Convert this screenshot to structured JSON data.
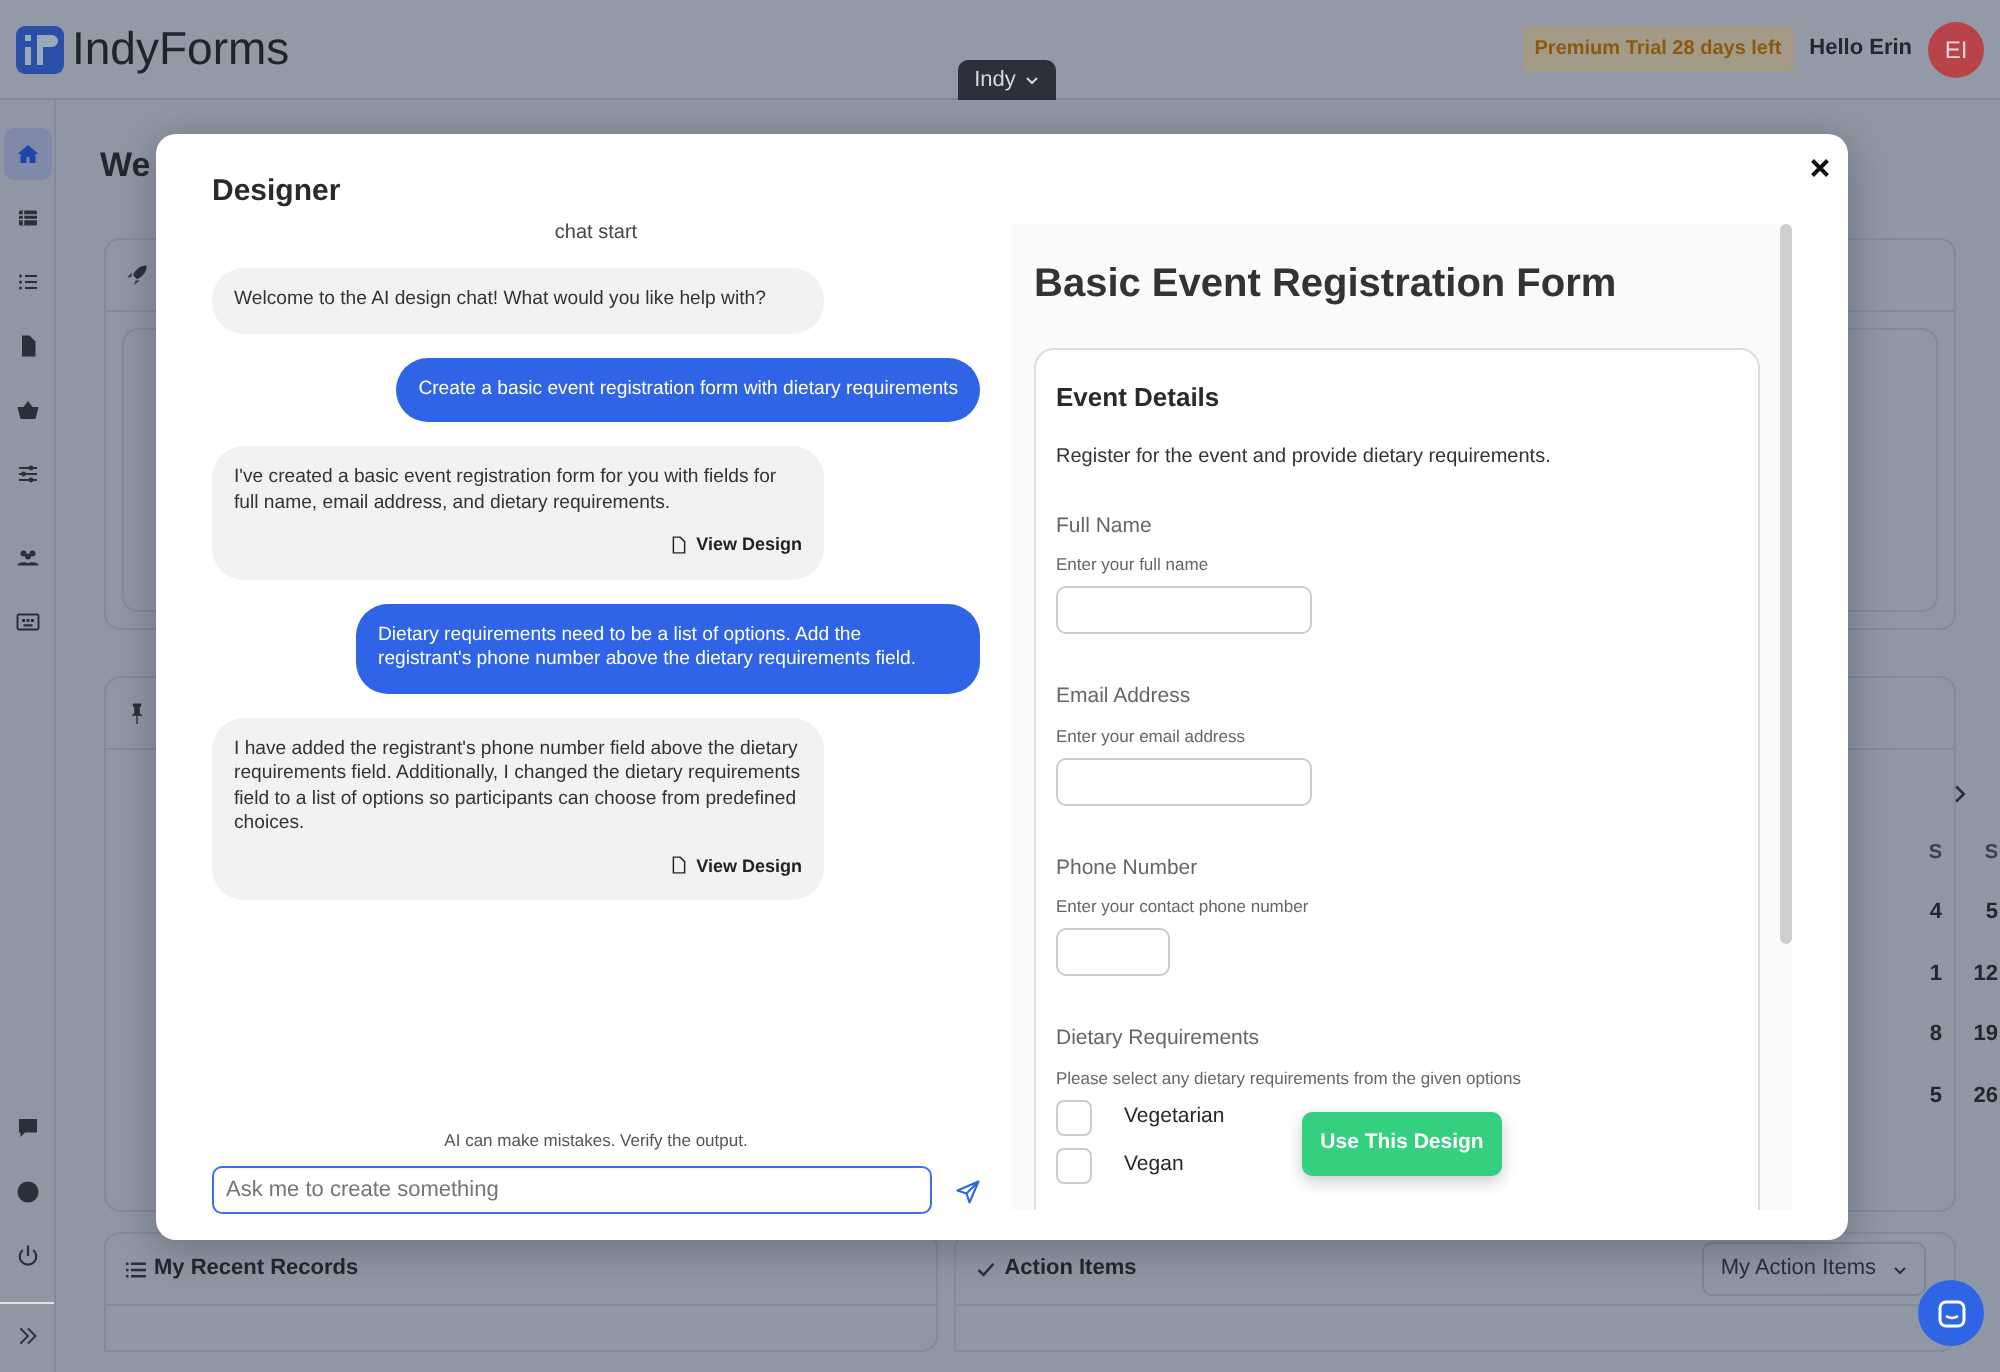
{
  "app": {
    "logo": "IndyForms",
    "workspace_tab": "Indy",
    "trial_badge": "Premium Trial 28 days left",
    "greeting": "Hello Erin",
    "avatar_initials": "EI"
  },
  "sidebar": {
    "items": [
      {
        "selected": true
      },
      {
        "selected": false
      },
      {
        "selected": false
      },
      {
        "selected": false
      },
      {
        "selected": false
      },
      {
        "selected": false
      },
      {
        "selected": false
      },
      {
        "selected": false
      }
    ],
    "bottom_items": [
      {
        "selected": false
      },
      {
        "selected": false
      },
      {
        "selected": false
      }
    ]
  },
  "background": {
    "heading": "We",
    "calendar": {
      "columns": [
        {
          "header": "S",
          "dates": [
            "4",
            "1",
            "8",
            "5"
          ]
        },
        {
          "header": "S",
          "dates": [
            "5",
            "12",
            "19",
            "26"
          ]
        }
      ]
    },
    "bottom_cards": [
      {
        "title": "My Recent Records"
      },
      {
        "title": "Action Items",
        "dropdown": "My Action Items"
      }
    ]
  },
  "modal": {
    "title": "Designer",
    "chat": {
      "start_label": "chat start",
      "messages": [
        {
          "kind": "assistant",
          "text": "Welcome to the AI design chat! What would you like help with?"
        },
        {
          "kind": "user",
          "text": "Create a basic event registration form with dietary requirements"
        },
        {
          "kind": "assistant",
          "text": "I've created a basic event registration form for you with fields for full name, email address, and dietary requirements.",
          "action": "View Design"
        },
        {
          "kind": "user",
          "text": "Dietary requirements need to be a list of options. Add the registrant's phone number above the dietary requirements field."
        },
        {
          "kind": "assistant",
          "text": "I have added the registrant's phone number field above the dietary requirements field. Additionally, I changed the dietary requirements field to a list of options so participants can choose from predefined choices.",
          "action": "View Design"
        }
      ],
      "disclaimer": "AI can make mistakes. Verify the output.",
      "input": {
        "placeholder": "Ask me to create something"
      }
    },
    "preview": {
      "title": "Basic Event Registration Form",
      "section": {
        "title": "Event Details",
        "description": "Register for the event and provide dietary requirements.",
        "fields": [
          {
            "kind": "text",
            "label": "Full Name",
            "hint": "Enter your full name"
          },
          {
            "kind": "text",
            "label": "Email Address",
            "hint": "Enter your email address"
          },
          {
            "kind": "short",
            "label": "Phone Number",
            "hint": "Enter your contact phone number"
          },
          {
            "kind": "options",
            "label": "Dietary Requirements",
            "hint": "Please select any dietary requirements from the given options",
            "options": [
              {
                "label": "Vegetarian",
                "checked": false
              },
              {
                "label": "Vegan",
                "checked": false
              }
            ]
          }
        ]
      }
    },
    "use_button": "Use This Design"
  }
}
